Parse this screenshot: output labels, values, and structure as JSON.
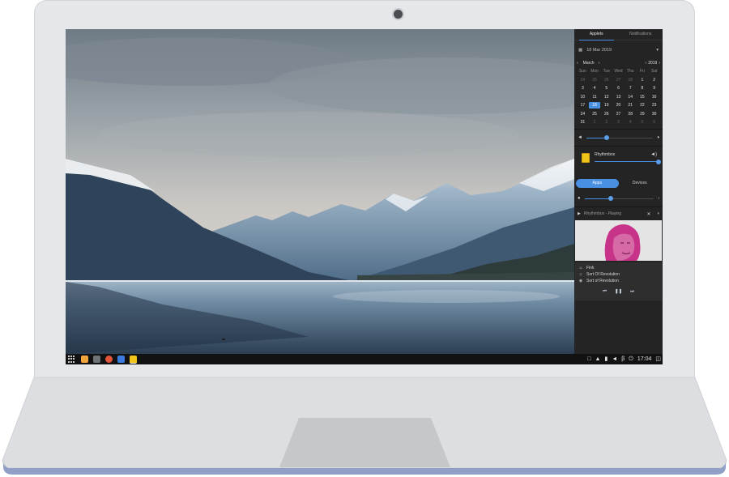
{
  "panel": {
    "tabs": [
      {
        "label": "Applets",
        "active": true
      },
      {
        "label": "Notifications",
        "active": false
      }
    ],
    "date_label": "18 Mar 2019",
    "calendar": {
      "month": "March",
      "year": "2019",
      "weekdays": [
        "Sun",
        "Mon",
        "Tue",
        "Wed",
        "Thu",
        "Fri",
        "Sat"
      ],
      "weeks": [
        [
          "24",
          "25",
          "26",
          "27",
          "28",
          "1",
          "2"
        ],
        [
          "3",
          "4",
          "5",
          "6",
          "7",
          "8",
          "9"
        ],
        [
          "10",
          "11",
          "12",
          "13",
          "14",
          "15",
          "16"
        ],
        [
          "17",
          "18",
          "19",
          "20",
          "21",
          "22",
          "23"
        ],
        [
          "24",
          "25",
          "26",
          "27",
          "28",
          "29",
          "30"
        ],
        [
          "31",
          "1",
          "2",
          "3",
          "4",
          "5",
          "6"
        ]
      ],
      "selected_day": "18"
    },
    "output_volume_fraction": 0.3,
    "player_app": "Rhythmbox",
    "app_volume_fraction": 1.0,
    "segments": [
      {
        "label": "Apps",
        "active": true
      },
      {
        "label": "Devices",
        "active": false
      }
    ],
    "mic_volume_fraction": 0.38,
    "now_playing": {
      "header": "Rhythmbox - Playing",
      "artist": "Fink",
      "title": "Sort Of Revolution",
      "album": "Sort of Revolution"
    }
  },
  "taskbar": {
    "clock": "17:04"
  },
  "colors": {
    "accent": "#4a90e2",
    "panel_bg": "#242424",
    "taskbar_bg": "#121212",
    "laptop_body": "#e6e7ea"
  },
  "icons": {
    "panel": [
      "calendar-icon",
      "chevron-down-icon",
      "chevron-left-icon",
      "chevron-right-icon",
      "speaker-icon",
      "mic-icon",
      "play-icon",
      "close-icon"
    ],
    "taskbar": [
      "app-grid-icon",
      "files-icon",
      "terminal-icon",
      "firefox-icon",
      "chat-icon",
      "rhythmbox-icon",
      "notification-icon",
      "bell-icon",
      "battery-icon",
      "volume-icon",
      "bluetooth-icon",
      "power-icon",
      "panel-toggle-icon"
    ]
  }
}
